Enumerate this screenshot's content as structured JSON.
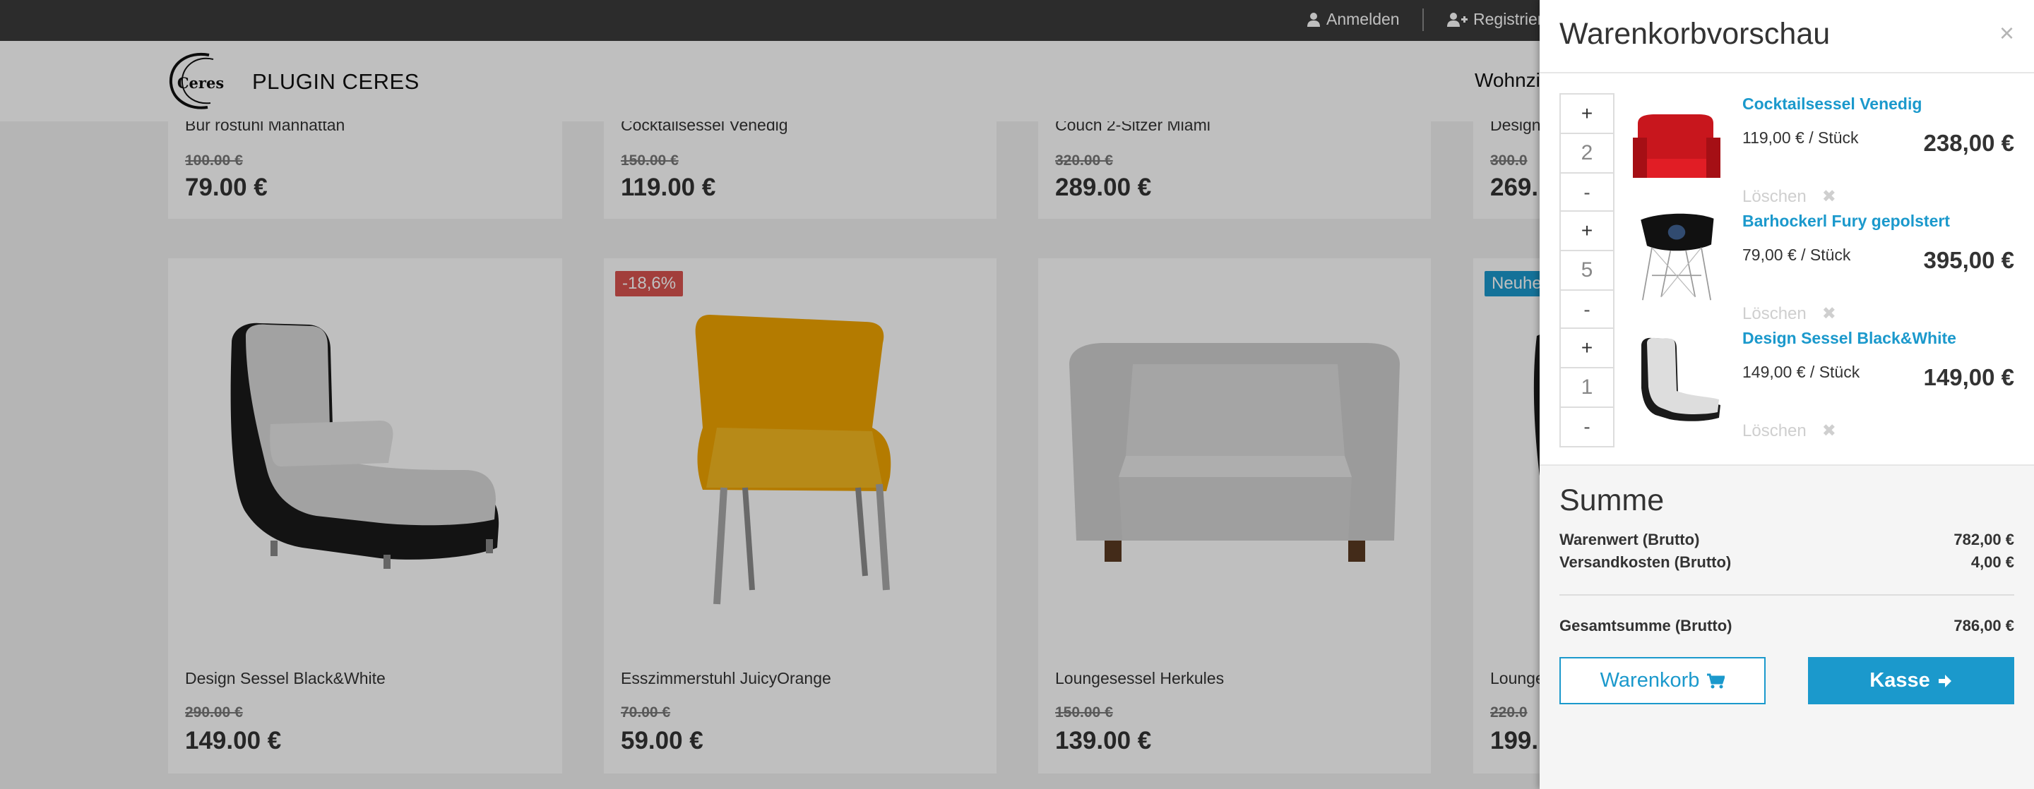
{
  "topbar": {
    "login_label": "Anmelden",
    "register_label": "Registrier"
  },
  "header": {
    "brand_name": "PLUGIN CERES",
    "logo_text": "Ceres",
    "nav_partial": "Wohnzi"
  },
  "products": {
    "row1": [
      {
        "name": "Bür rostuhl Manhattan",
        "old_price": "100.00 €",
        "price": "79.00 €"
      },
      {
        "name": "Cocktailsessel Venedig",
        "old_price": "150.00 €",
        "price": "119.00 €"
      },
      {
        "name": "Couch 2-Sitzer Miami",
        "old_price": "320.00 €",
        "price": "289.00 €"
      },
      {
        "name": "Design",
        "old_price": "300.0",
        "price": "269."
      }
    ],
    "row2": [
      {
        "name": "Design Sessel Black&White",
        "old_price": "290.00 €",
        "price": "149.00 €",
        "badge": ""
      },
      {
        "name": "Esszimmerstuhl JuicyOrange",
        "old_price": "70.00 €",
        "price": "59.00 €",
        "badge": "-18,6%"
      },
      {
        "name": "Loungesessel Herkules",
        "old_price": "150.00 €",
        "price": "139.00 €",
        "badge": ""
      },
      {
        "name": "Lounge",
        "old_price": "220.0",
        "price": "199.",
        "badge": "Neuhe"
      }
    ]
  },
  "cart": {
    "title": "Warenkorbvorschau",
    "close_symbol": "×",
    "delete_label": "Löschen",
    "delete_symbol": "✖",
    "plus_symbol": "+",
    "minus_symbol": "-",
    "items": [
      {
        "name": "Cocktailsessel Venedig",
        "quantity": "2",
        "unit_price": "119,00 € / Stück",
        "total": "238,00 €"
      },
      {
        "name": "Barhockerl Fury gepolstert",
        "quantity": "5",
        "unit_price": "79,00 € / Stück",
        "total": "395,00 €"
      },
      {
        "name": "Design Sessel Black&White",
        "quantity": "1",
        "unit_price": "149,00 € / Stück",
        "total": "149,00 €"
      }
    ],
    "summary": {
      "title": "Summe",
      "goods_label": "Warenwert (Brutto)",
      "goods_value": "782,00 €",
      "shipping_label": "Versandkosten (Brutto)",
      "shipping_value": "4,00 €",
      "total_label": "Gesamtsumme (Brutto)",
      "total_value": "786,00 €"
    },
    "cart_button_label": "Warenkorb",
    "checkout_button_label": "Kasse"
  },
  "colors": {
    "accent": "#1b99cc",
    "sale_badge": "#d9534f",
    "new_badge": "#1b99cc",
    "topbar": "#3b3b3b"
  }
}
